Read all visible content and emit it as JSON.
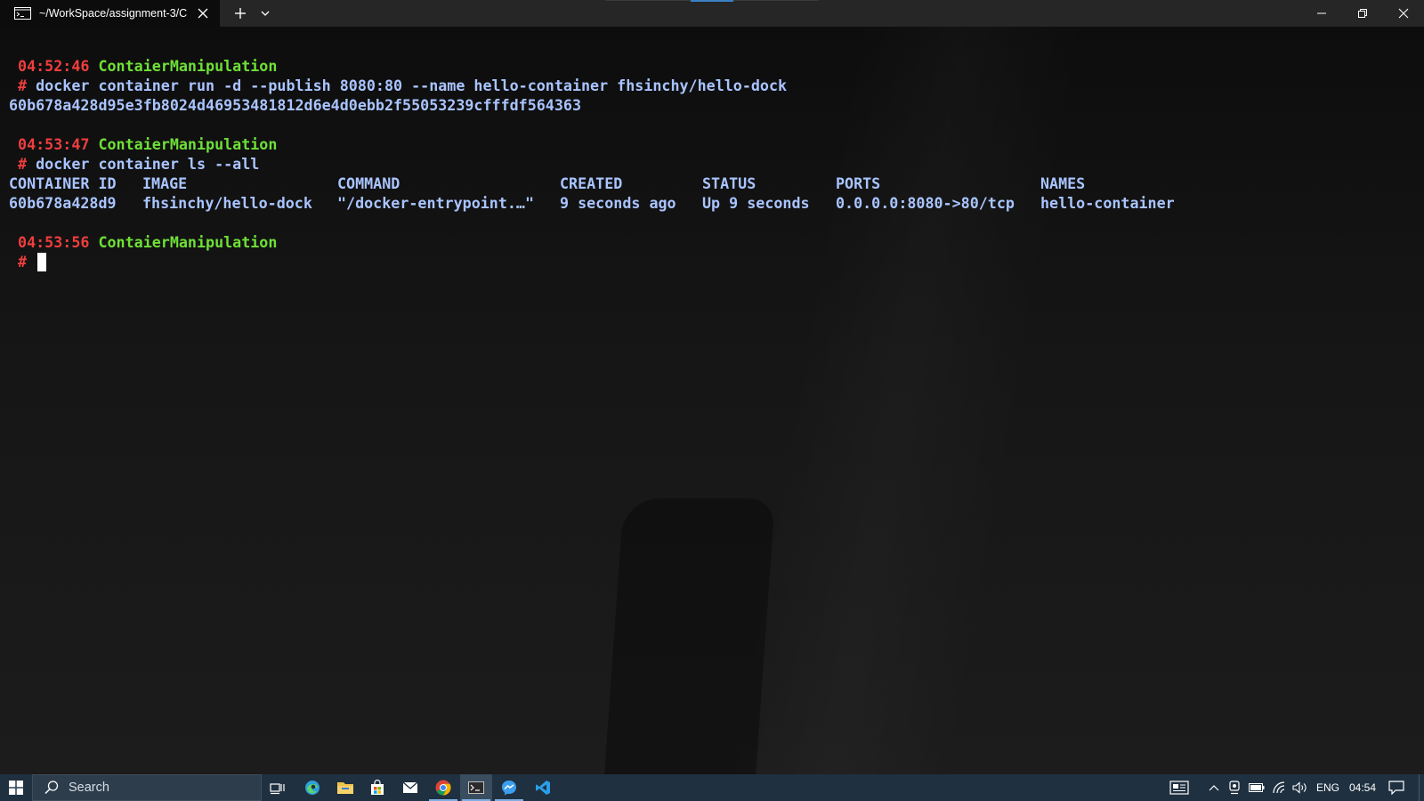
{
  "window": {
    "tab_title": "~/WorkSpace/assignment-3/C",
    "new_tab_label": "+",
    "controls": [
      "minimize",
      "restore",
      "close"
    ]
  },
  "terminal": {
    "blocks": [
      {
        "time": "04:52:46",
        "dir": "ContaierManipulation",
        "prompt": "#",
        "command": "docker container run -d --publish 8080:80 --name hello-container fhsinchy/hello-dock",
        "output": "60b678a428d95e3fb8024d46953481812d6e4d0ebb2f55053239cfffdf564363"
      },
      {
        "time": "04:53:47",
        "dir": "ContaierManipulation",
        "prompt": "#",
        "command": "docker container ls --all",
        "table": {
          "headers": [
            "CONTAINER ID",
            "IMAGE",
            "COMMAND",
            "CREATED",
            "STATUS",
            "PORTS",
            "NAMES"
          ],
          "rows": [
            [
              "60b678a428d9",
              "fhsinchy/hello-dock",
              "\"/docker-entrypoint.…\"",
              "9 seconds ago",
              "Up 9 seconds",
              "0.0.0.0:8080->80/tcp",
              "hello-container"
            ]
          ]
        }
      },
      {
        "time": "04:53:56",
        "dir": "ContaierManipulation",
        "prompt": "#",
        "command": ""
      }
    ],
    "colors": {
      "time": "#f03e3e",
      "dir": "#6ee037",
      "text": "#a9c4ff"
    }
  },
  "taskbar": {
    "search_placeholder": "Search",
    "apps": [
      "task-view",
      "edge",
      "file-explorer",
      "store",
      "mail",
      "chrome",
      "terminal",
      "messenger",
      "vscode"
    ],
    "tray": {
      "language": "ENG",
      "clock": "04:54"
    }
  }
}
